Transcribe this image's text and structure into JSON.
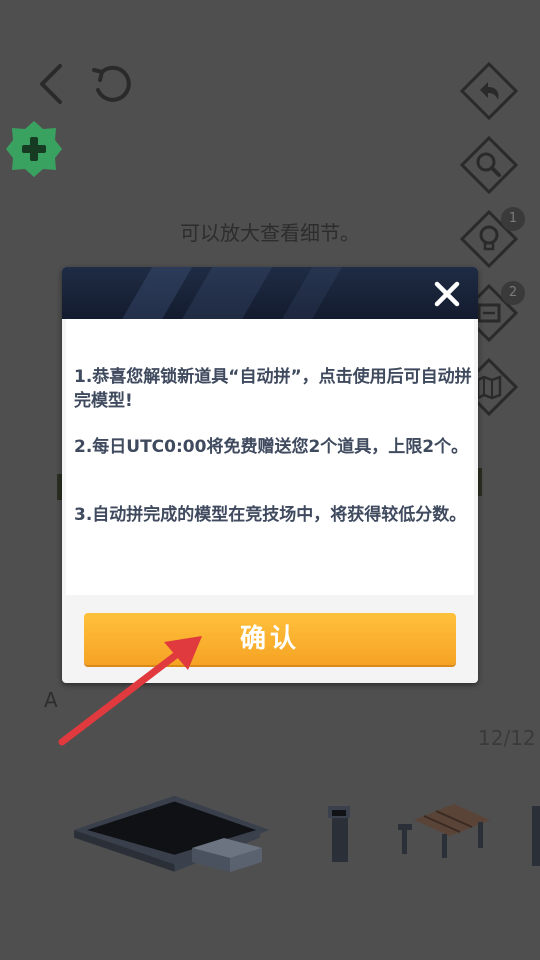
{
  "game": {
    "hint_text": "可以放大查看细节。",
    "side_buttons": [
      {
        "icon": "undo-icon"
      },
      {
        "icon": "magnifier-icon"
      },
      {
        "icon": "lightbulb-icon",
        "badge": "1"
      },
      {
        "icon": "auto-build-icon",
        "badge": "2"
      },
      {
        "icon": "map-icon"
      }
    ],
    "letter_label": "A",
    "page_count": "12/12"
  },
  "dialog": {
    "paragraphs": [
      "1.恭喜您解锁新道具“自动拼”，点击使用后可自动拼完模型!",
      "2.每日UTC0:00将免费赠送您2个道具，上限2个。",
      "3.自动拼完成的模型在竞技场中，将获得较低分数。"
    ],
    "confirm_label": "确认"
  },
  "colors": {
    "overlay": "#4f4f4f",
    "header_dark": "#1a2439",
    "button_orange": "#f7a927",
    "add_green": "#3aa260",
    "arrow_red": "#e0393e"
  }
}
